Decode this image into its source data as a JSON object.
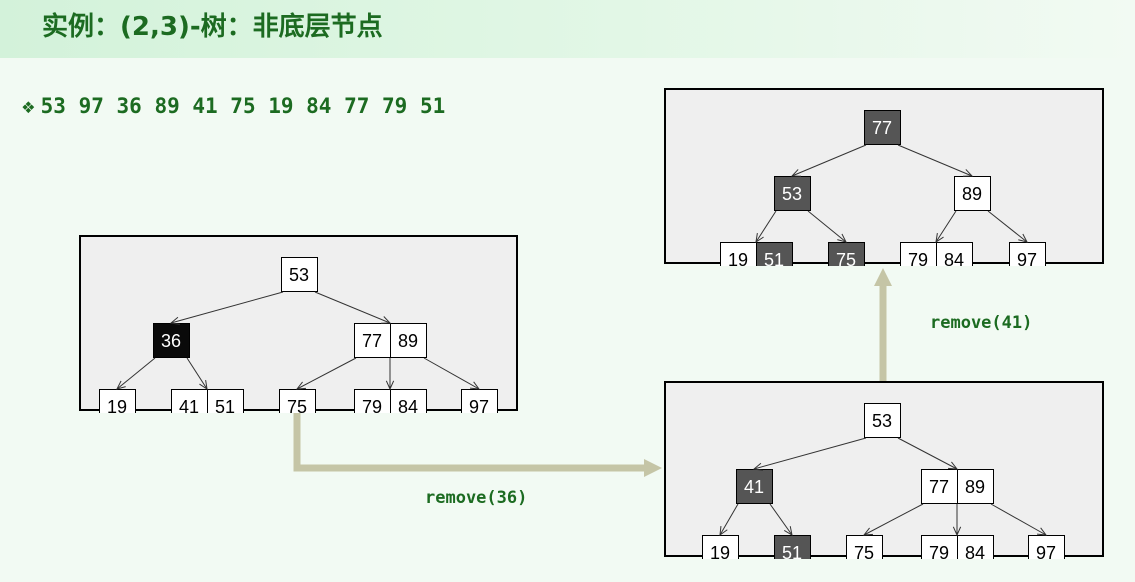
{
  "title": "实例：(2,3)-树：非底层节点",
  "sequence": {
    "bullet": "❖",
    "values": "53 97 36 89 41 75 19 84 77 79 51"
  },
  "operations": {
    "first": "remove(36)",
    "second": "remove(41)"
  },
  "colors": {
    "title": "#1c6b21",
    "arrow": "#c5c5a6",
    "highlight_black": "#0a0a0a",
    "highlight_gray": "#555555"
  },
  "trees": {
    "initial": {
      "root": {
        "keys": [
          "53"
        ],
        "styles": [
          "plain"
        ]
      },
      "level1": [
        {
          "keys": [
            "36"
          ],
          "styles": [
            "black"
          ]
        },
        {
          "keys": [
            "77",
            "89"
          ],
          "styles": [
            "plain",
            "plain"
          ]
        }
      ],
      "level2": [
        {
          "keys": [
            "19"
          ],
          "styles": [
            "plain"
          ],
          "parent": 0
        },
        {
          "keys": [
            "41",
            "51"
          ],
          "styles": [
            "plain",
            "plain"
          ],
          "parent": 0
        },
        {
          "keys": [
            "75"
          ],
          "styles": [
            "plain"
          ],
          "parent": 1
        },
        {
          "keys": [
            "79",
            "84"
          ],
          "styles": [
            "plain",
            "plain"
          ],
          "parent": 1
        },
        {
          "keys": [
            "97"
          ],
          "styles": [
            "plain"
          ],
          "parent": 1
        }
      ]
    },
    "after_remove_36": {
      "root": {
        "keys": [
          "53"
        ],
        "styles": [
          "plain"
        ]
      },
      "level1": [
        {
          "keys": [
            "41"
          ],
          "styles": [
            "gray"
          ]
        },
        {
          "keys": [
            "77",
            "89"
          ],
          "styles": [
            "plain",
            "plain"
          ]
        }
      ],
      "level2": [
        {
          "keys": [
            "19"
          ],
          "styles": [
            "plain"
          ],
          "parent": 0
        },
        {
          "keys": [
            "51"
          ],
          "styles": [
            "gray"
          ],
          "parent": 0
        },
        {
          "keys": [
            "75"
          ],
          "styles": [
            "plain"
          ],
          "parent": 1
        },
        {
          "keys": [
            "79",
            "84"
          ],
          "styles": [
            "plain",
            "plain"
          ],
          "parent": 1
        },
        {
          "keys": [
            "97"
          ],
          "styles": [
            "plain"
          ],
          "parent": 1
        }
      ]
    },
    "after_remove_41": {
      "root": {
        "keys": [
          "77"
        ],
        "styles": [
          "gray"
        ]
      },
      "level1": [
        {
          "keys": [
            "53"
          ],
          "styles": [
            "gray"
          ]
        },
        {
          "keys": [
            "89"
          ],
          "styles": [
            "plain"
          ]
        }
      ],
      "level2": [
        {
          "keys": [
            "19",
            "51"
          ],
          "styles": [
            "plain",
            "gray"
          ],
          "parent": 0
        },
        {
          "keys": [
            "75"
          ],
          "styles": [
            "gray"
          ],
          "parent": 0
        },
        {
          "keys": [
            "79",
            "84"
          ],
          "styles": [
            "plain",
            "plain"
          ],
          "parent": 1
        },
        {
          "keys": [
            "97"
          ],
          "styles": [
            "plain"
          ],
          "parent": 1
        }
      ]
    }
  }
}
